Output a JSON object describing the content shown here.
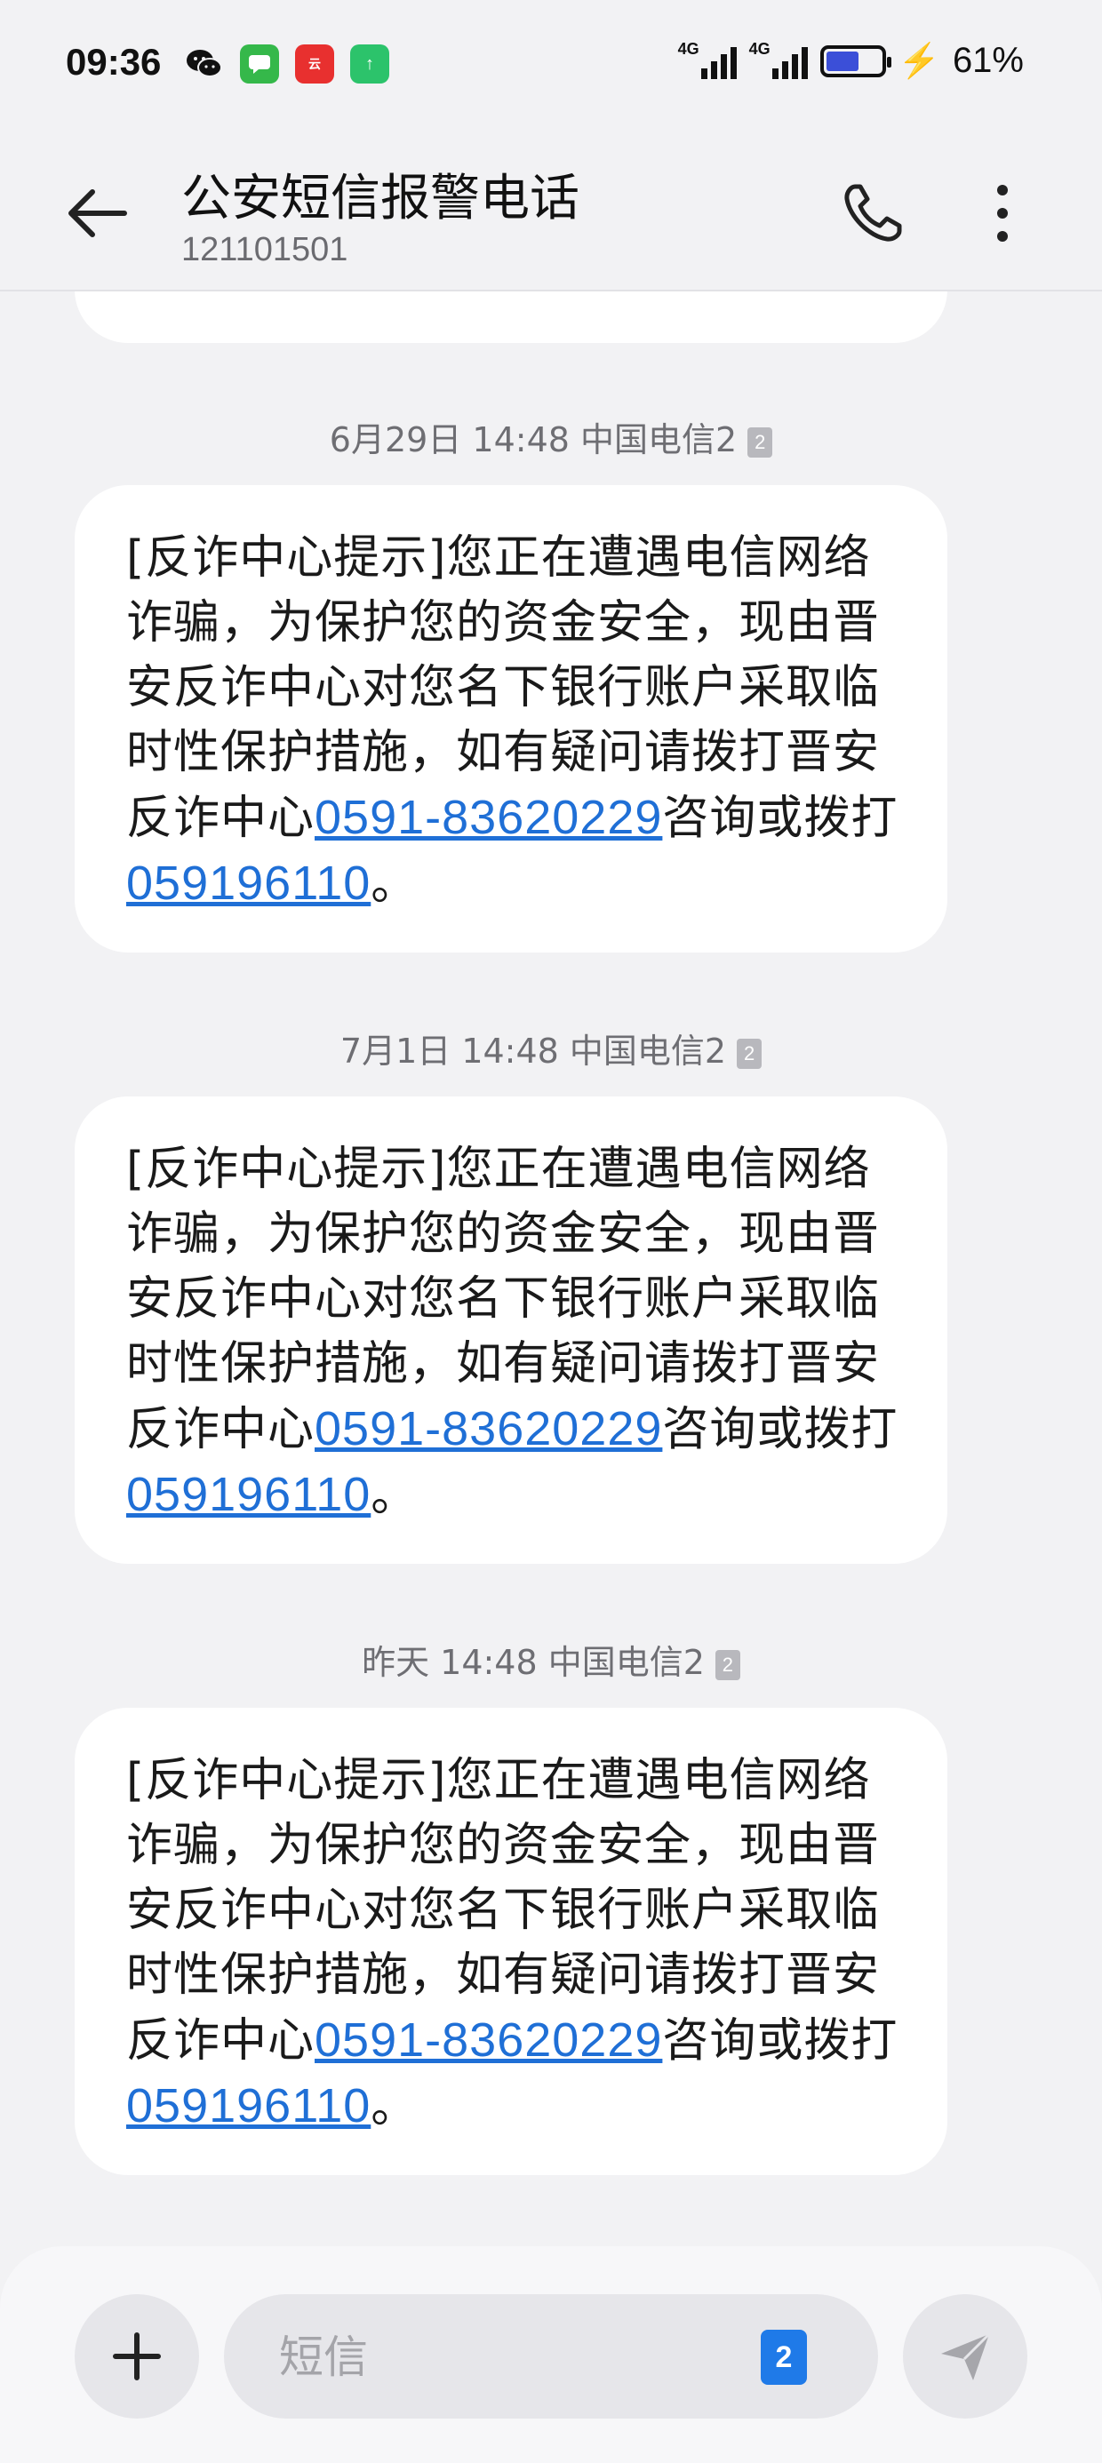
{
  "status_bar": {
    "time": "09:36",
    "notification_icons": [
      "wechat-icon",
      "messages-icon",
      "alipay-icon",
      "fliggy-icon"
    ],
    "network_1": "4G",
    "network_2": "4G",
    "battery_percent": "61%",
    "battery_level": 0.61
  },
  "header": {
    "title": "公安短信报警电话",
    "subtitle": "121101501"
  },
  "messages": [
    {
      "timestamp": "6月29日 14:48 中国电信2",
      "sim": "2",
      "text_before": "[反诈中心提示]您正在遭遇电信网络诈骗，为保护您的资金安全，现由晋安反诈中心对您名下银行账户采取临时性保护措施，如有疑问请拨打晋安反诈中心",
      "link1": "0591-83620229",
      "text_mid": "咨询或拨打",
      "link2": "059196110",
      "text_end": "。"
    },
    {
      "timestamp": "7月1日 14:48 中国电信2",
      "sim": "2",
      "text_before": "[反诈中心提示]您正在遭遇电信网络诈骗，为保护您的资金安全，现由晋安反诈中心对您名下银行账户采取临时性保护措施，如有疑问请拨打晋安反诈中心",
      "link1": "0591-83620229",
      "text_mid": "咨询或拨打",
      "link2": "059196110",
      "text_end": "。"
    },
    {
      "timestamp": "昨天 14:48 中国电信2",
      "sim": "2",
      "text_before": "[反诈中心提示]您正在遭遇电信网络诈骗，为保护您的资金安全，现由晋安反诈中心对您名下银行账户采取临时性保护措施，如有疑问请拨打晋安反诈中心",
      "link1": "0591-83620229",
      "text_mid": "咨询或拨打",
      "link2": "059196110",
      "text_end": "。"
    }
  ],
  "compose": {
    "placeholder": "短信",
    "sim": "2"
  },
  "colors": {
    "link": "#1f6fd6",
    "sim_badge": "#1f7ae8",
    "background": "#f2f2f4"
  }
}
